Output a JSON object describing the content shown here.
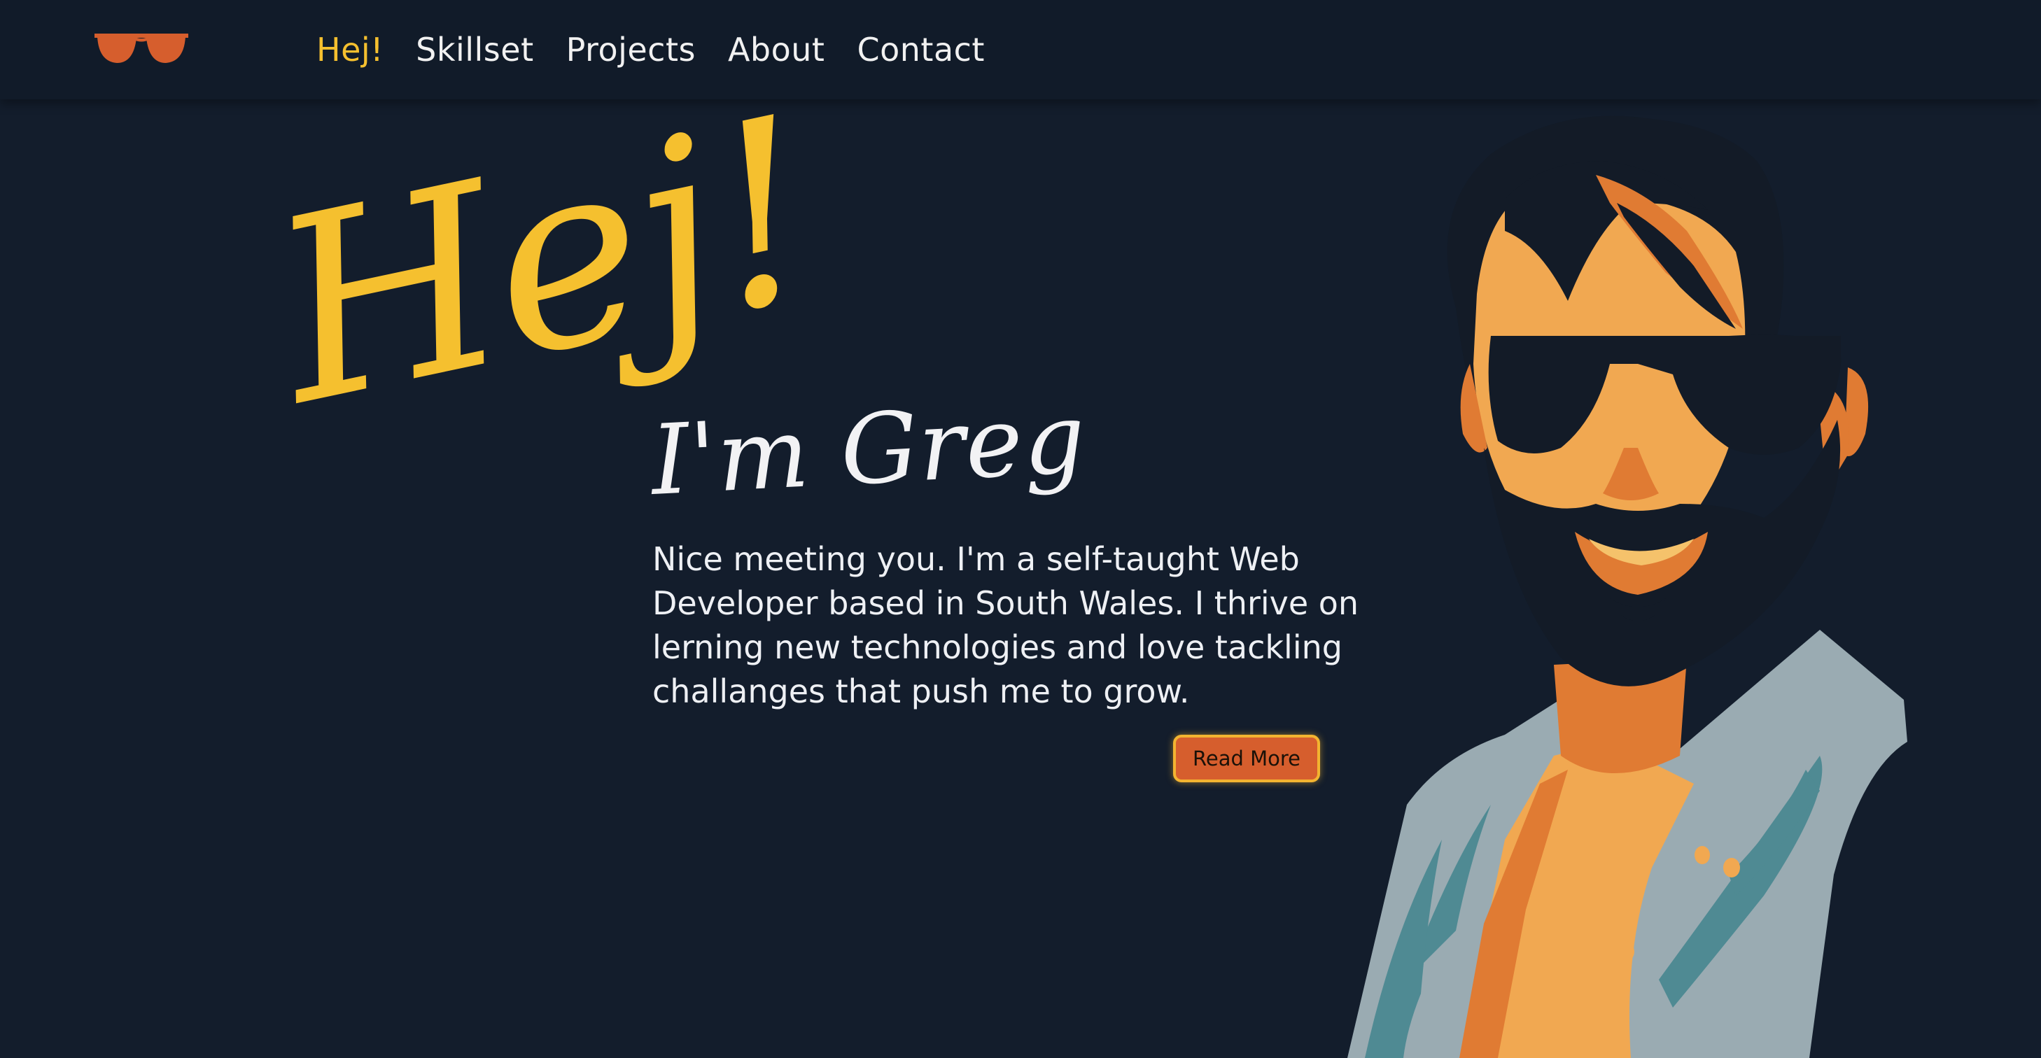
{
  "nav": {
    "logo_icon": "sunglasses-icon",
    "links": [
      {
        "label": "Hej!",
        "active": true
      },
      {
        "label": "Skillset",
        "active": false
      },
      {
        "label": "Projects",
        "active": false
      },
      {
        "label": "About",
        "active": false
      },
      {
        "label": "Contact",
        "active": false
      }
    ]
  },
  "hero": {
    "greeting": "Hej!",
    "name": "I'm Greg",
    "intro_lines": [
      "Nice meeting you. I'm a self-taught Web",
      "Developer based in South Wales. I thrive on",
      "lerning new technologies and love tackling",
      "challanges that push me to grow."
    ],
    "read_more_label": "Read More",
    "illustration": "bearded-man-sunglasses-portrait"
  },
  "colors": {
    "background": "#131d2c",
    "navbar": "#111b29",
    "accent_yellow": "#f5c02f",
    "accent_orange": "#d65e2d",
    "text": "#eef0f4"
  }
}
